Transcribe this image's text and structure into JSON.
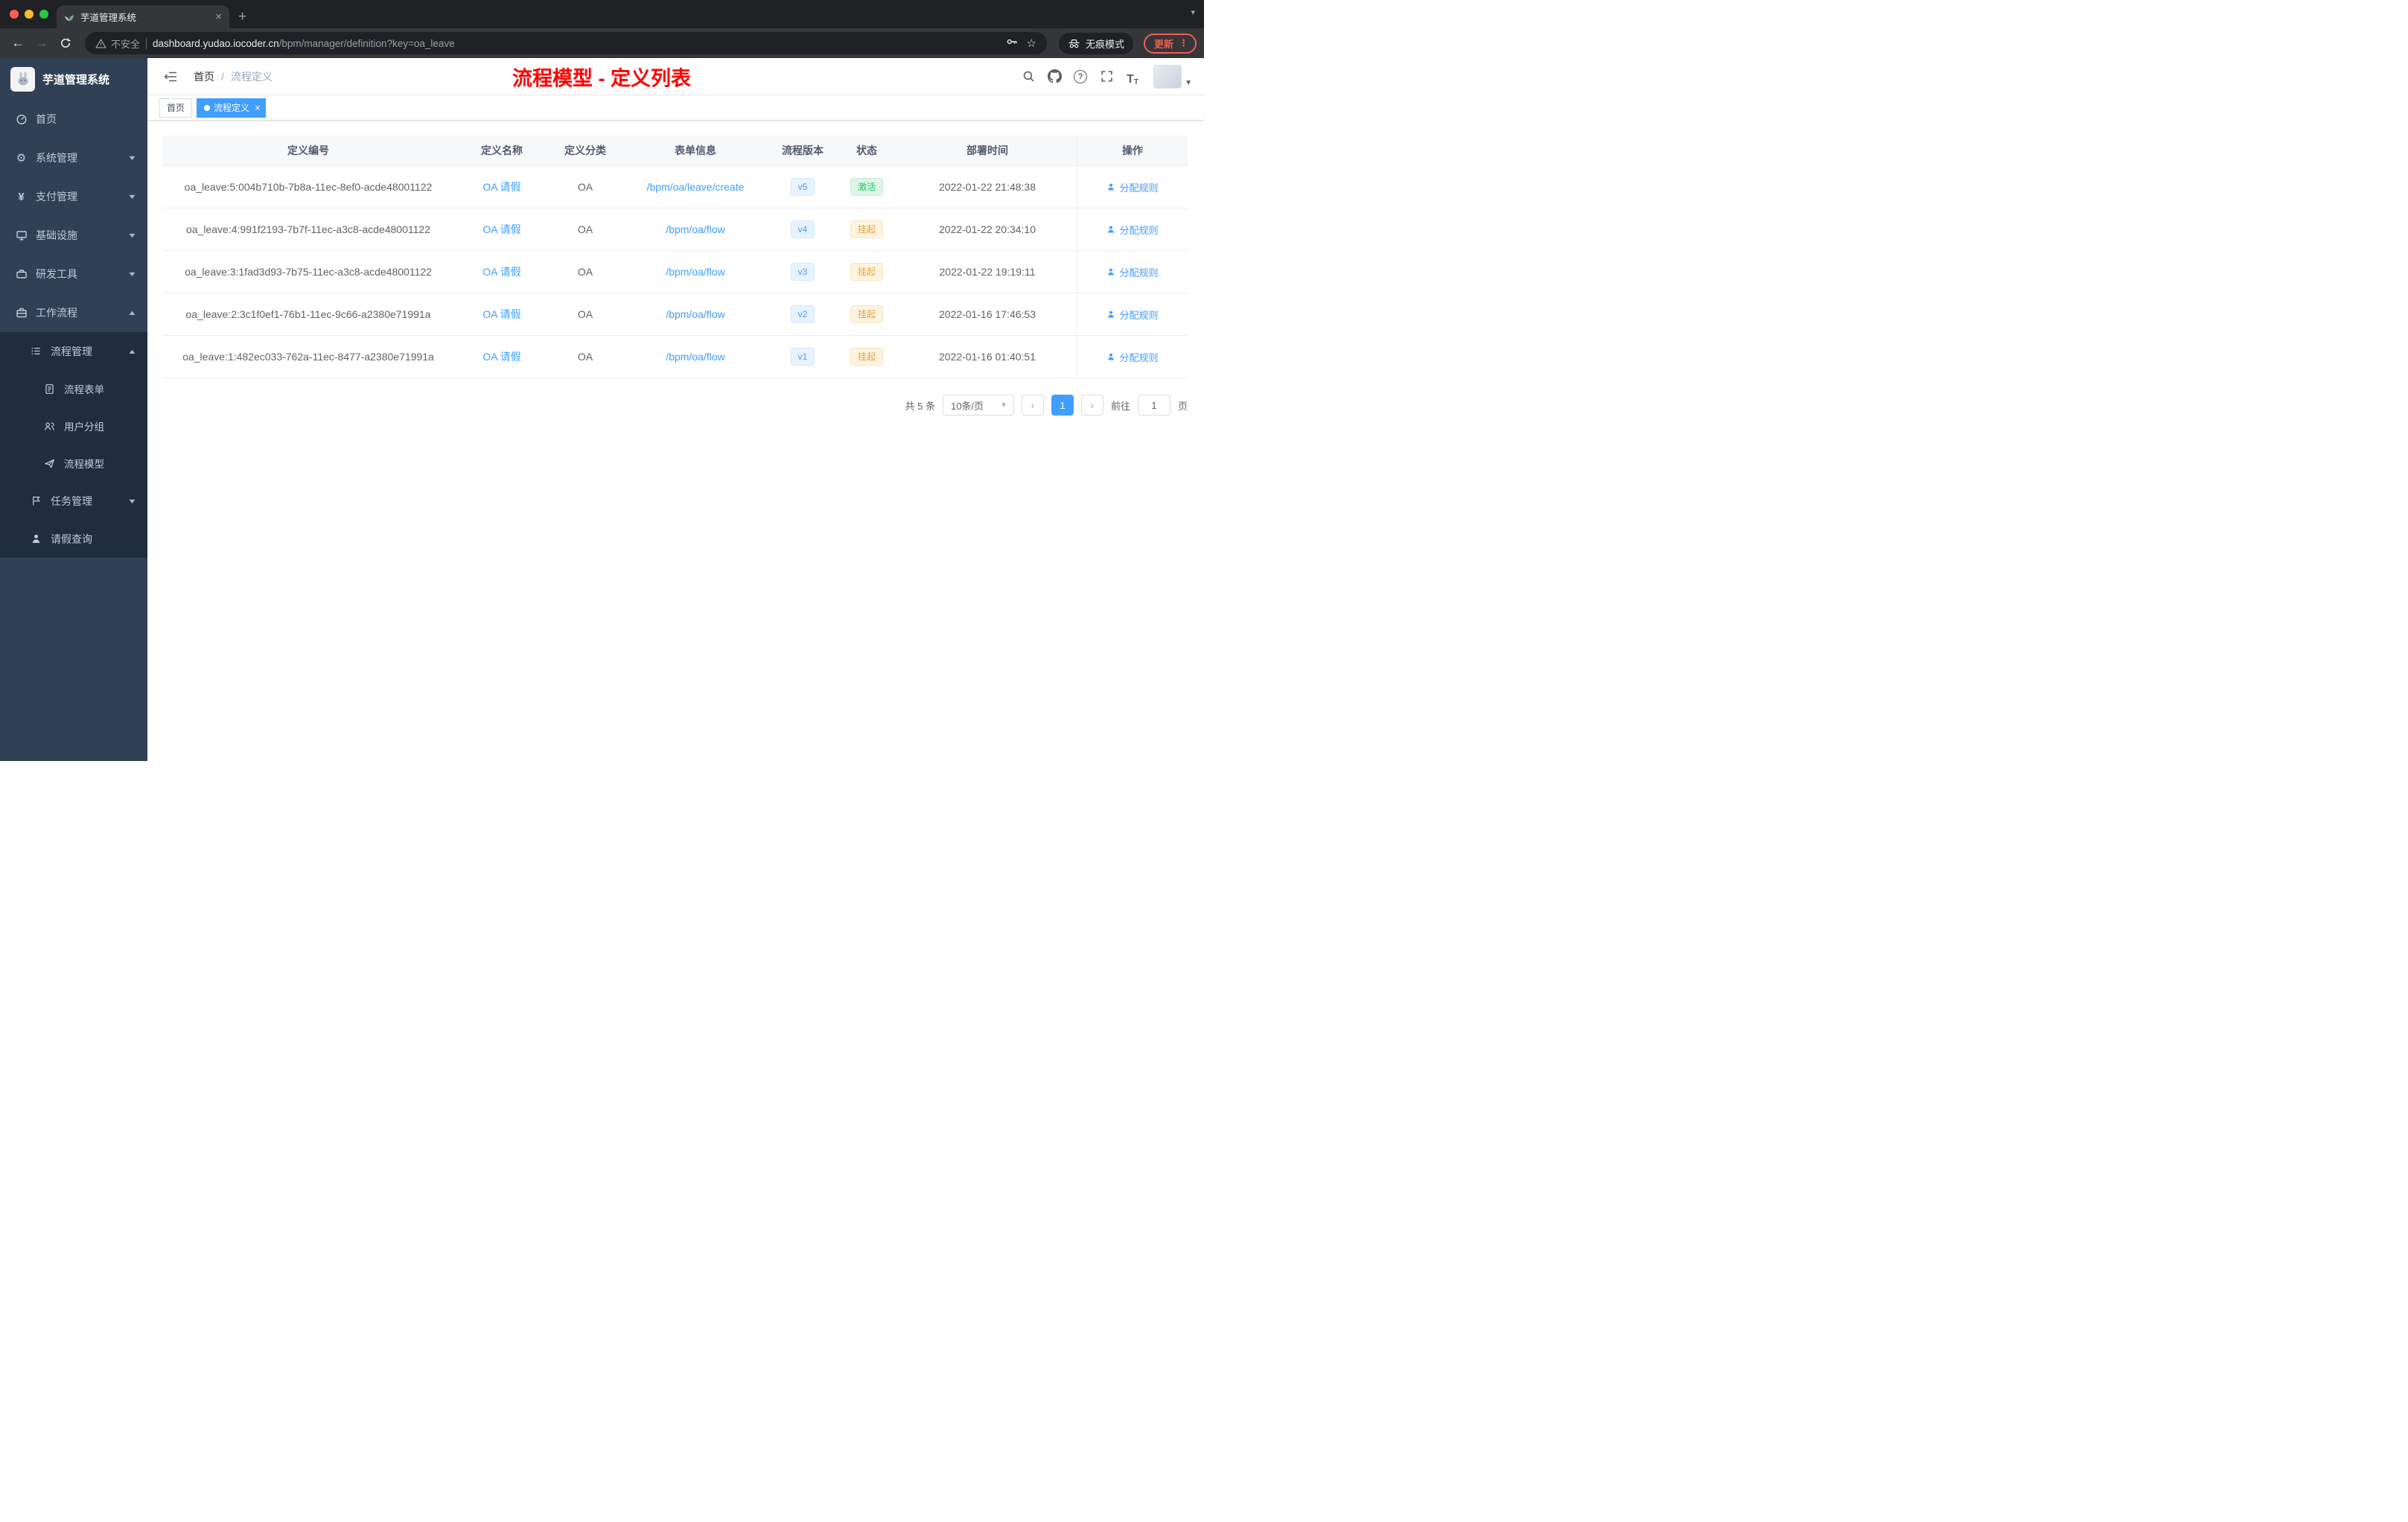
{
  "browser": {
    "tab_title": "芋道管理系统",
    "security_label": "不安全",
    "url_domain": "dashboard.yudao.iocoder.cn",
    "url_path": "/bpm/manager/definition?key=oa_leave",
    "incognito_label": "无痕模式",
    "update_label": "更新"
  },
  "sidebar": {
    "logo_title": "芋道管理系统",
    "menu": [
      {
        "label": "首页"
      },
      {
        "label": "系统管理"
      },
      {
        "label": "支付管理"
      },
      {
        "label": "基础设施"
      },
      {
        "label": "研发工具"
      },
      {
        "label": "工作流程"
      },
      {
        "label": "流程管理"
      },
      {
        "label": "流程表单"
      },
      {
        "label": "用户分组"
      },
      {
        "label": "流程模型"
      },
      {
        "label": "任务管理"
      },
      {
        "label": "请假查询"
      }
    ]
  },
  "header": {
    "breadcrumb_home": "首页",
    "breadcrumb_sep": "/",
    "breadcrumb_current": "流程定义",
    "page_title": "流程模型 - 定义列表"
  },
  "tags": {
    "home": "首页",
    "active": "流程定义"
  },
  "table": {
    "columns": [
      "定义编号",
      "定义名称",
      "定义分类",
      "表单信息",
      "流程版本",
      "状态",
      "部署时间",
      "操作"
    ],
    "rows": [
      {
        "id": "oa_leave:5:004b710b-7b8a-11ec-8ef0-acde48001122",
        "name": "OA 请假",
        "category": "OA",
        "form": "/bpm/oa/leave/create",
        "version": "v5",
        "status": "激活",
        "time": "2022-01-22 21:48:38",
        "action": "分配规则"
      },
      {
        "id": "oa_leave:4:991f2193-7b7f-11ec-a3c8-acde48001122",
        "name": "OA 请假",
        "category": "OA",
        "form": "/bpm/oa/flow",
        "version": "v4",
        "status": "挂起",
        "time": "2022-01-22 20:34:10",
        "action": "分配规则"
      },
      {
        "id": "oa_leave:3:1fad3d93-7b75-11ec-a3c8-acde48001122",
        "name": "OA 请假",
        "category": "OA",
        "form": "/bpm/oa/flow",
        "version": "v3",
        "status": "挂起",
        "time": "2022-01-22 19:19:11",
        "action": "分配规则"
      },
      {
        "id": "oa_leave:2:3c1f0ef1-76b1-11ec-9c66-a2380e71991a",
        "name": "OA 请假",
        "category": "OA",
        "form": "/bpm/oa/flow",
        "version": "v2",
        "status": "挂起",
        "time": "2022-01-16 17:46:53",
        "action": "分配规则"
      },
      {
        "id": "oa_leave:1:482ec033-762a-11ec-8477-a2380e71991a",
        "name": "OA 请假",
        "category": "OA",
        "form": "/bpm/oa/flow",
        "version": "v1",
        "status": "挂起",
        "time": "2022-01-16 01:40:51",
        "action": "分配规则"
      }
    ]
  },
  "pagination": {
    "total": "共 5 条",
    "page_size": "10条/页",
    "page": "1",
    "goto_label": "前往",
    "goto_value": "1",
    "unit_label": "页"
  },
  "colors": {
    "accent": "#409EFF",
    "title_red": "#FF0000",
    "status_active_text": "#13CE66",
    "status_suspended_text": "#E6A23C",
    "sidebar_bg": "#304156",
    "submenu_bg": "#1F2D3D"
  }
}
